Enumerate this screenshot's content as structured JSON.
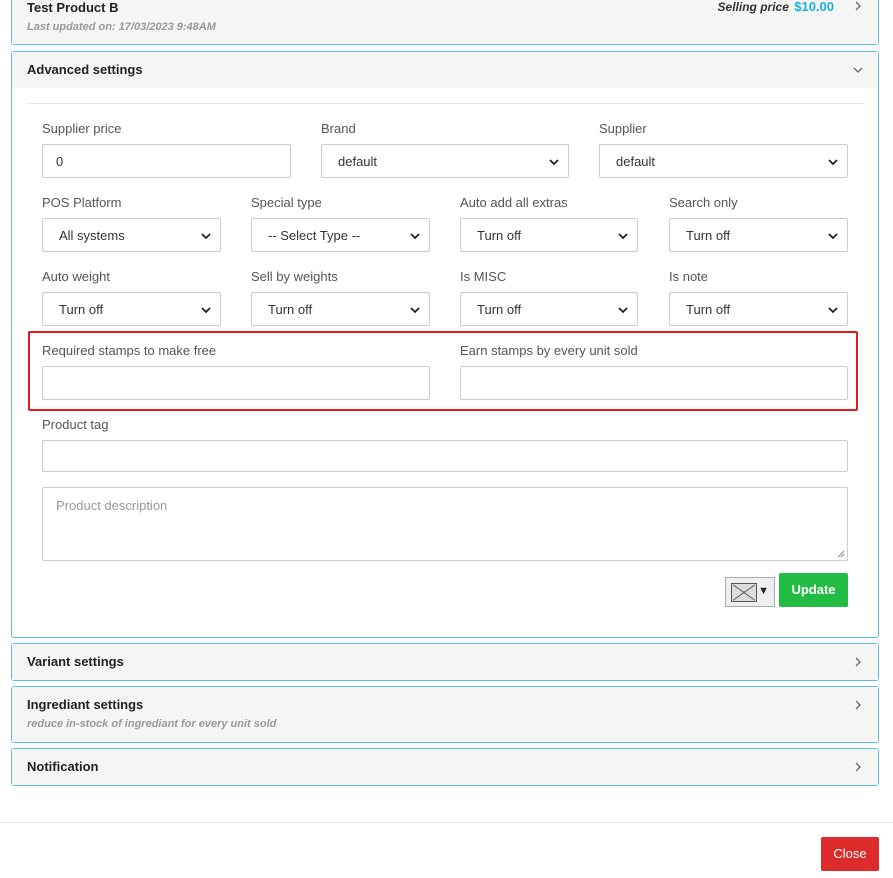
{
  "product": {
    "name": "Test Product B",
    "last_updated": "Last updated on: 17/03/2023 9:48AM",
    "selling_price_label": "Selling price",
    "selling_price_value": "$10.00"
  },
  "advanced": {
    "title": "Advanced settings",
    "supplier_price": {
      "label": "Supplier price",
      "value": "0"
    },
    "brand": {
      "label": "Brand",
      "value": "default"
    },
    "supplier": {
      "label": "Supplier",
      "value": "default"
    },
    "pos_platform": {
      "label": "POS Platform",
      "value": "All systems"
    },
    "special_type": {
      "label": "Special type",
      "value": "-- Select Type --"
    },
    "auto_add_extras": {
      "label": "Auto add all extras",
      "value": "Turn off"
    },
    "search_only": {
      "label": "Search only",
      "value": "Turn off"
    },
    "auto_weight": {
      "label": "Auto weight",
      "value": "Turn off"
    },
    "sell_by_weights": {
      "label": "Sell by weights",
      "value": "Turn off"
    },
    "is_misc": {
      "label": "Is MISC",
      "value": "Turn off"
    },
    "is_note": {
      "label": "Is note",
      "value": "Turn off"
    },
    "required_stamps": {
      "label": "Required stamps to make free",
      "value": ""
    },
    "earn_stamps": {
      "label": "Earn stamps by every unit sold",
      "value": ""
    },
    "product_tag": {
      "label": "Product tag",
      "value": ""
    },
    "description_placeholder": "Product description",
    "update_label": "Update"
  },
  "variant": {
    "title": "Variant settings"
  },
  "ingredient": {
    "title": "Ingrediant settings",
    "subtitle": "reduce in-stock of ingrediant for every unit sold"
  },
  "notification": {
    "title": "Notification"
  },
  "footer": {
    "close_label": "Close"
  },
  "colors": {
    "accent": "#5bc0de",
    "price": "#1ab0e0",
    "update": "#22bb44",
    "close": "#dd2a2a",
    "highlight": "#e01b1b"
  }
}
